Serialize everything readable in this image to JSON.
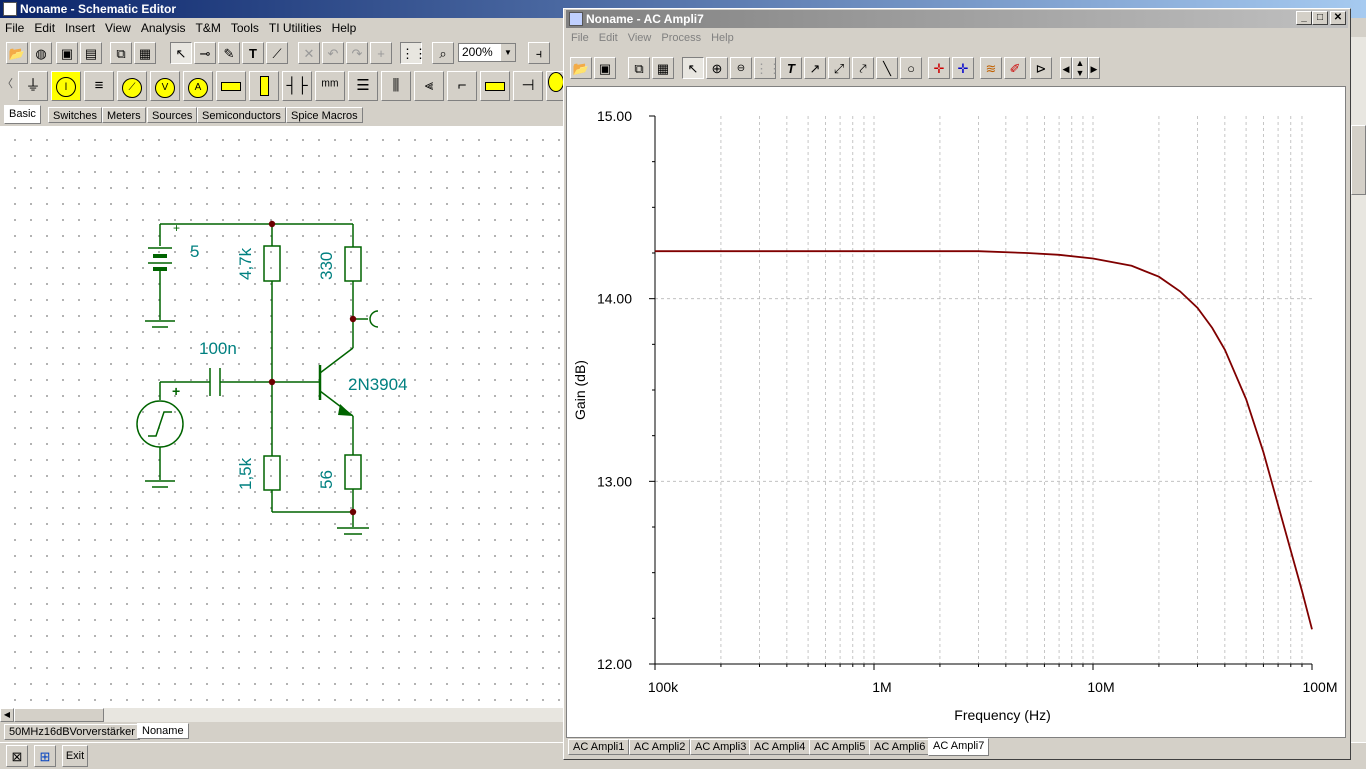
{
  "schematic_window": {
    "title": "Noname - Schematic Editor",
    "menu": [
      "File",
      "Edit",
      "Insert",
      "View",
      "Analysis",
      "T&M",
      "Tools",
      "TI Utilities",
      "Help"
    ],
    "zoom": "200%",
    "component_tabs": [
      "Basic",
      "Switches",
      "Meters",
      "Sources",
      "Semiconductors",
      "Spice Macros"
    ],
    "active_tab": "Basic",
    "document_tabs": [
      "50MHz16dBVorverstärker",
      "Noname"
    ],
    "active_document": "Noname",
    "exit_label": "Exit",
    "circuit": {
      "battery_voltage": "5",
      "r_top_left": "4,7k",
      "r_collector": "330",
      "capacitor": "100n",
      "transistor": "2N3904",
      "r_bottom_left": "1,5k",
      "r_emitter": "56",
      "plus_sign": "+"
    }
  },
  "ac_window": {
    "title": "Noname - AC Ampli7",
    "menu": [
      "File",
      "Edit",
      "View",
      "Process",
      "Help"
    ],
    "result_tabs": [
      "AC Ampli1",
      "AC Ampli2",
      "AC Ampli3",
      "AC Ampli4",
      "AC Ampli5",
      "AC Ampli6",
      "AC Ampli7"
    ],
    "active_result_tab": "AC Ampli7"
  },
  "chart_data": {
    "type": "line",
    "xlabel": "Frequency (Hz)",
    "ylabel": "Gain (dB)",
    "x_scale": "log",
    "xlim": [
      100000,
      100000000
    ],
    "ylim": [
      12.0,
      15.0
    ],
    "x_tick_labels": [
      "100k",
      "1M",
      "10M",
      "100M"
    ],
    "y_tick_labels": [
      "12.00",
      "13.00",
      "14.00",
      "15.00"
    ],
    "grid": true,
    "line_color": "#800000",
    "series": [
      {
        "x": [
          100000,
          300000,
          1000000,
          3000000,
          5000000,
          7000000,
          10000000,
          15000000,
          20000000,
          25000000,
          30000000,
          35000000,
          40000000,
          50000000,
          60000000,
          70000000,
          80000000,
          90000000,
          100000000
        ],
        "values": [
          14.26,
          14.26,
          14.26,
          14.26,
          14.25,
          14.24,
          14.22,
          14.18,
          14.12,
          14.04,
          13.95,
          13.84,
          13.72,
          13.45,
          13.16,
          12.87,
          12.62,
          12.4,
          12.19
        ]
      }
    ]
  }
}
